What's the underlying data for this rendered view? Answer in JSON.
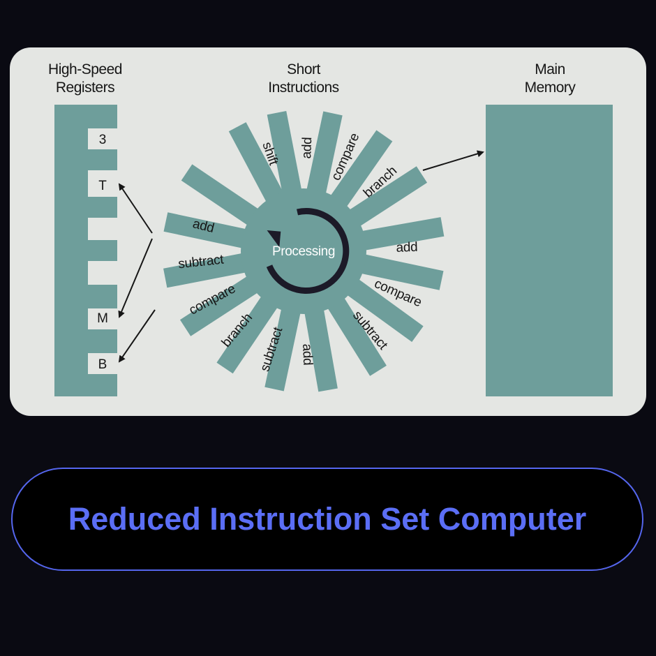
{
  "diagram": {
    "headers": {
      "registers": [
        "High-Speed",
        "Registers"
      ],
      "instructions": [
        "Short",
        "Instructions"
      ],
      "memory": [
        "Main",
        "Memory"
      ]
    },
    "registers": [
      "3",
      "T",
      "M",
      "B"
    ],
    "center_label": "Processing",
    "spokes": [
      "shift",
      "add",
      "compare",
      "branch",
      "add",
      "compare",
      "subtract",
      "add",
      "subtract",
      "branch",
      "compare",
      "subtract",
      "add"
    ],
    "colors": {
      "card": "#e4e6e3",
      "teal": "#6e9e9b",
      "ink": "#161616",
      "arrow_ring": "#1c1a28"
    }
  },
  "banner": {
    "title": "Reduced Instruction Set Computer",
    "color": "#5b6ef5"
  }
}
